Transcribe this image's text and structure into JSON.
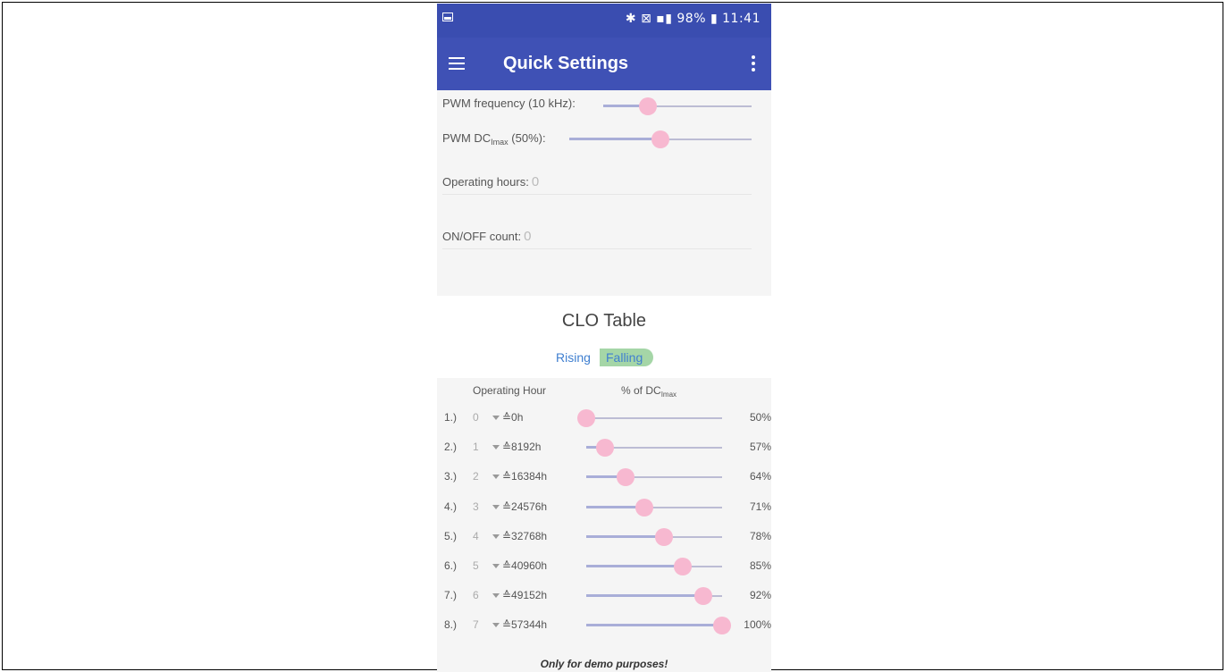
{
  "status_bar": {
    "icons_text": "✱ ⊠ ▪▮ 98%",
    "battery_icon": "battery-icon",
    "time": "11:41"
  },
  "app_bar": {
    "title": "Quick Settings",
    "menu_icon": "hamburger-menu-icon",
    "overflow_icon": "more-vert-icon"
  },
  "settings": {
    "pwm_frequency_label": "PWM frequency (10 kHz):",
    "pwm_frequency_level": 0.3,
    "pwm_dc_label_prefix": "PWM DC",
    "pwm_dc_label_sub": "Imax",
    "pwm_dc_label_suffix": " (50%):",
    "pwm_dc_level": 0.5,
    "operating_hours_label": "Operating hours:",
    "operating_hours_value": "0",
    "onoff_count_label": "ON/OFF count:",
    "onoff_count_value": "0"
  },
  "clo_table": {
    "title": "CLO Table",
    "toggle_rising": "Rising",
    "toggle_falling": "Falling",
    "col_operating_hour": "Operating Hour",
    "col_dc_prefix": "% of DC",
    "col_dc_sub": "Imax",
    "rows": [
      {
        "idx": "1.)",
        "num": "0",
        "hours": "≙0h",
        "pct": "50%",
        "level": 0.0
      },
      {
        "idx": "2.)",
        "num": "1",
        "hours": "≙8192h",
        "pct": "57%",
        "level": 0.14
      },
      {
        "idx": "3.)",
        "num": "2",
        "hours": "≙16384h",
        "pct": "64%",
        "level": 0.29
      },
      {
        "idx": "4.)",
        "num": "3",
        "hours": "≙24576h",
        "pct": "71%",
        "level": 0.43
      },
      {
        "idx": "5.)",
        "num": "4",
        "hours": "≙32768h",
        "pct": "78%",
        "level": 0.57
      },
      {
        "idx": "6.)",
        "num": "5",
        "hours": "≙40960h",
        "pct": "85%",
        "level": 0.71
      },
      {
        "idx": "7.)",
        "num": "6",
        "hours": "≙49152h",
        "pct": "92%",
        "level": 0.86
      },
      {
        "idx": "8.)",
        "num": "7",
        "hours": "≙57344h",
        "pct": "100%",
        "level": 1.0
      }
    ]
  },
  "footer": "Only for demo purposes!",
  "colors": {
    "app_bar": "#3f51b5",
    "status_bar": "#3a4db0",
    "slider_thumb": "#f7b8d0",
    "toggle_active": "#a5d6a7",
    "link_blue": "#3f7fd0"
  }
}
